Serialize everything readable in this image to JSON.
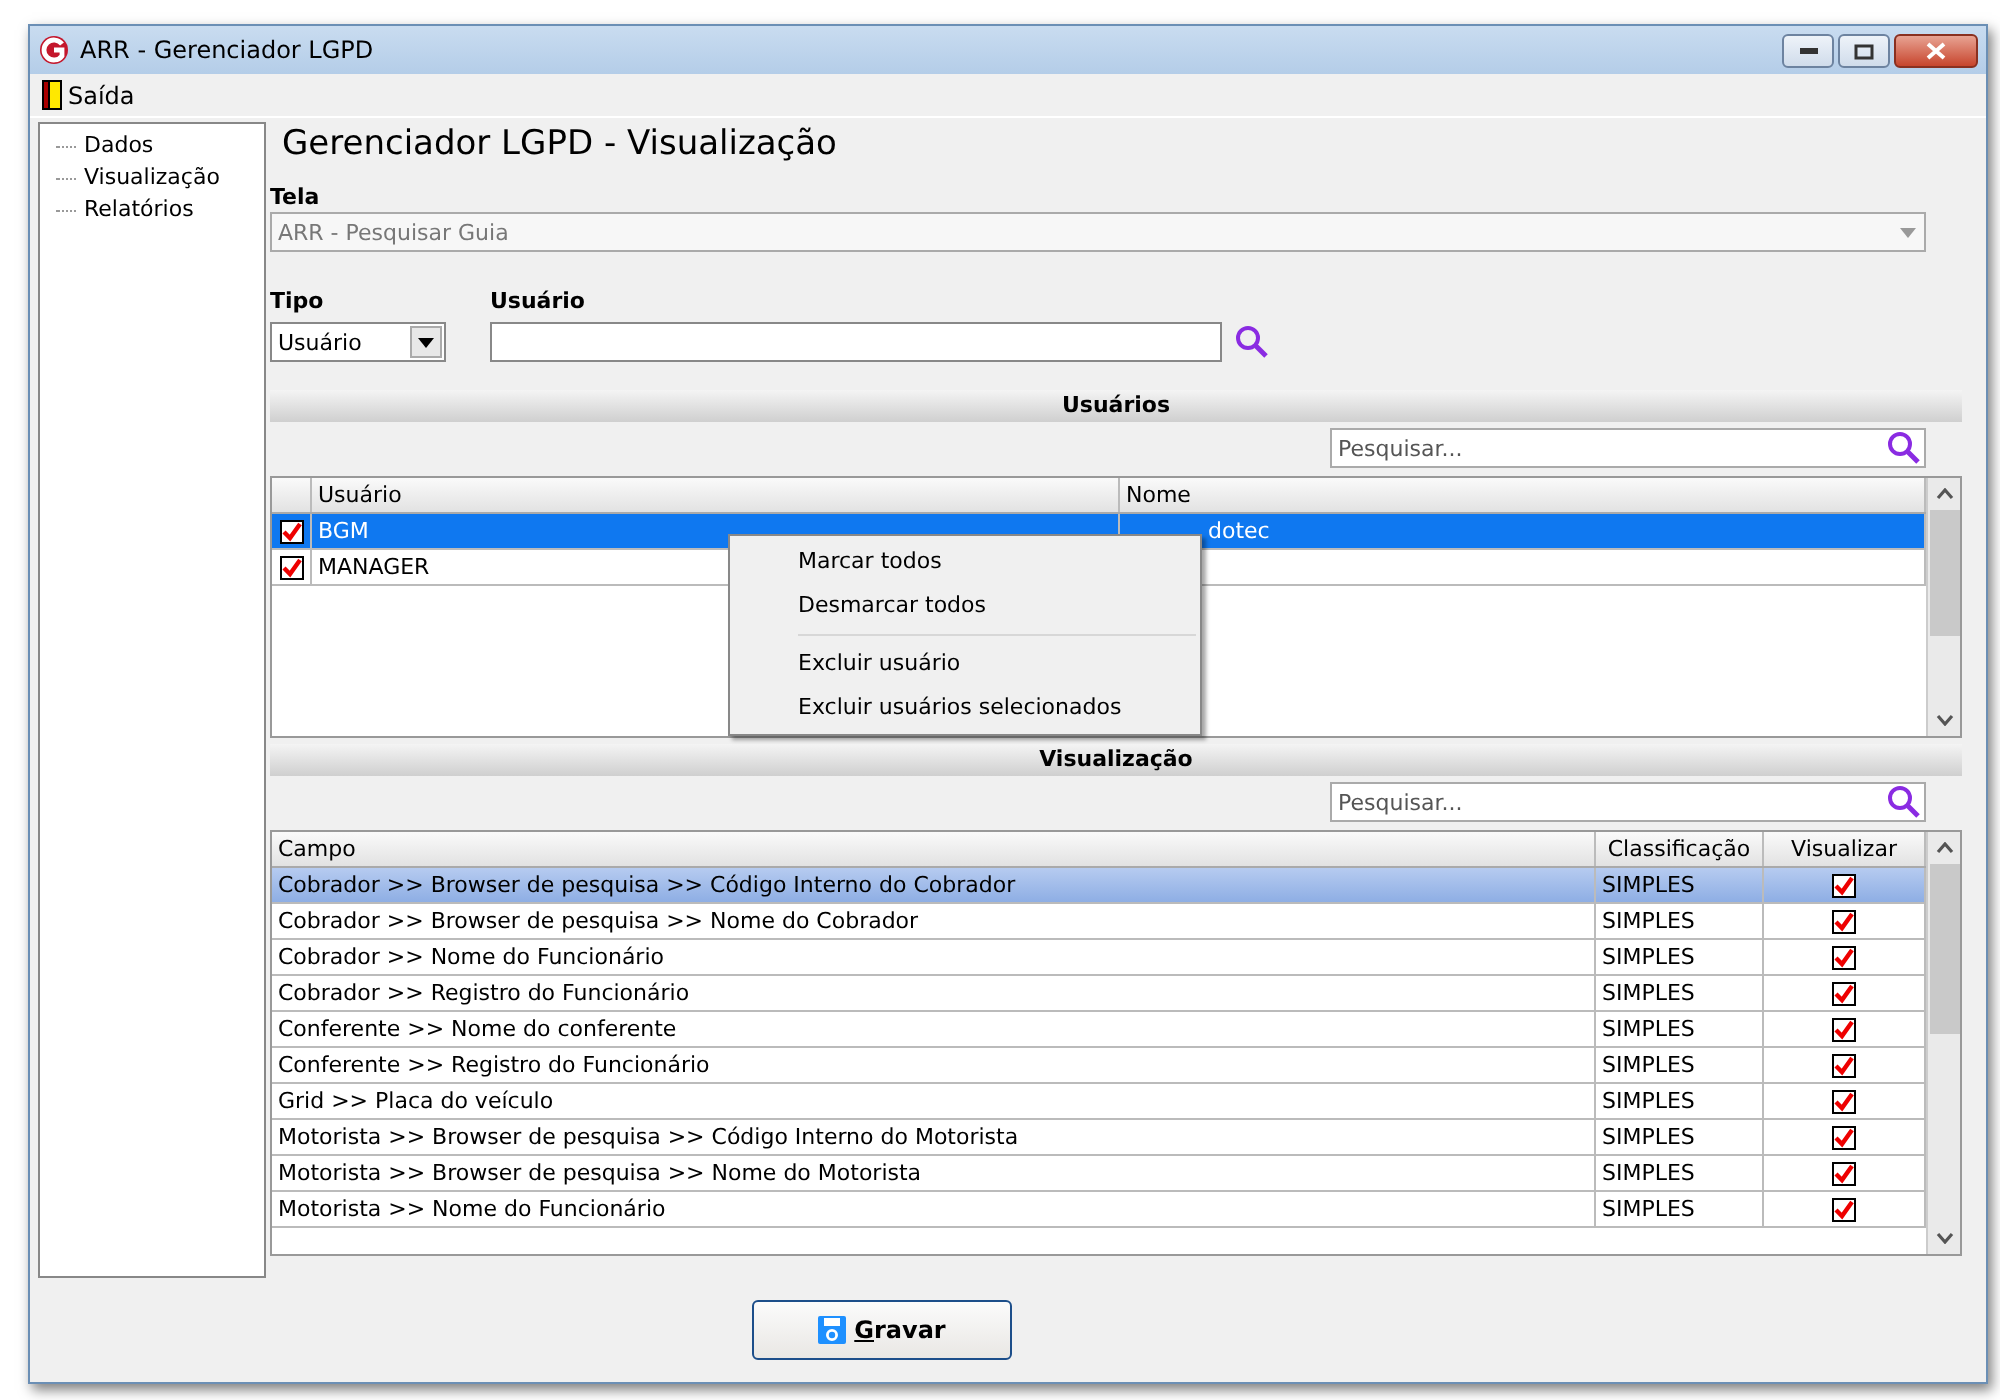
{
  "window": {
    "title": "ARR - Gerenciador LGPD"
  },
  "menu": [
    {
      "label": "Saída"
    }
  ],
  "sidebar": {
    "items": [
      {
        "label": "Dados"
      },
      {
        "label": "Visualização"
      },
      {
        "label": "Relatórios"
      }
    ]
  },
  "heading": "Gerenciador LGPD - Visualização",
  "tela": {
    "label": "Tela",
    "value": "ARR - Pesquisar Guia"
  },
  "tipo": {
    "label": "Tipo",
    "value": "Usuário"
  },
  "usuario": {
    "label": "Usuário"
  },
  "users_section": {
    "title": "Usuários",
    "search_placeholder": "Pesquisar...",
    "columns": [
      "Usuário",
      "Nome"
    ],
    "rows": [
      {
        "checked": true,
        "selected": true,
        "user": "BGM",
        "name": "dotec"
      },
      {
        "checked": true,
        "selected": false,
        "user": "MANAGER",
        "name": ""
      }
    ]
  },
  "context_menu": {
    "items": [
      {
        "kind": "item",
        "label": "Marcar todos"
      },
      {
        "kind": "item",
        "label": "Desmarcar todos"
      },
      {
        "kind": "separator"
      },
      {
        "kind": "item",
        "label": "Excluir usuário"
      },
      {
        "kind": "item",
        "label": "Excluir usuários selecionados"
      }
    ]
  },
  "view_section": {
    "title": "Visualização",
    "search_placeholder": "Pesquisar...",
    "columns": [
      "Campo",
      "Classificação",
      "Visualizar"
    ],
    "rows": [
      {
        "field": "Cobrador >> Browser de pesquisa >> Código Interno do Cobrador",
        "classification": "SIMPLES",
        "checked": true,
        "selected": true
      },
      {
        "field": "Cobrador >> Browser de pesquisa >> Nome do Cobrador",
        "classification": "SIMPLES",
        "checked": true,
        "selected": false
      },
      {
        "field": "Cobrador >> Nome do Funcionário",
        "classification": "SIMPLES",
        "checked": true,
        "selected": false
      },
      {
        "field": "Cobrador >> Registro do Funcionário",
        "classification": "SIMPLES",
        "checked": true,
        "selected": false
      },
      {
        "field": "Conferente >> Nome do conferente",
        "classification": "SIMPLES",
        "checked": true,
        "selected": false
      },
      {
        "field": "Conferente >> Registro do Funcionário",
        "classification": "SIMPLES",
        "checked": true,
        "selected": false
      },
      {
        "field": "Grid >> Placa do veículo",
        "classification": "SIMPLES",
        "checked": true,
        "selected": false
      },
      {
        "field": "Motorista >> Browser de pesquisa >> Código Interno do Motorista",
        "classification": "SIMPLES",
        "checked": true,
        "selected": false
      },
      {
        "field": "Motorista >> Browser de pesquisa >> Nome do Motorista",
        "classification": "SIMPLES",
        "checked": true,
        "selected": false
      },
      {
        "field": "Motorista >> Nome do Funcionário",
        "classification": "SIMPLES",
        "checked": true,
        "selected": false
      }
    ]
  },
  "save_button": {
    "label": "Gravar"
  }
}
